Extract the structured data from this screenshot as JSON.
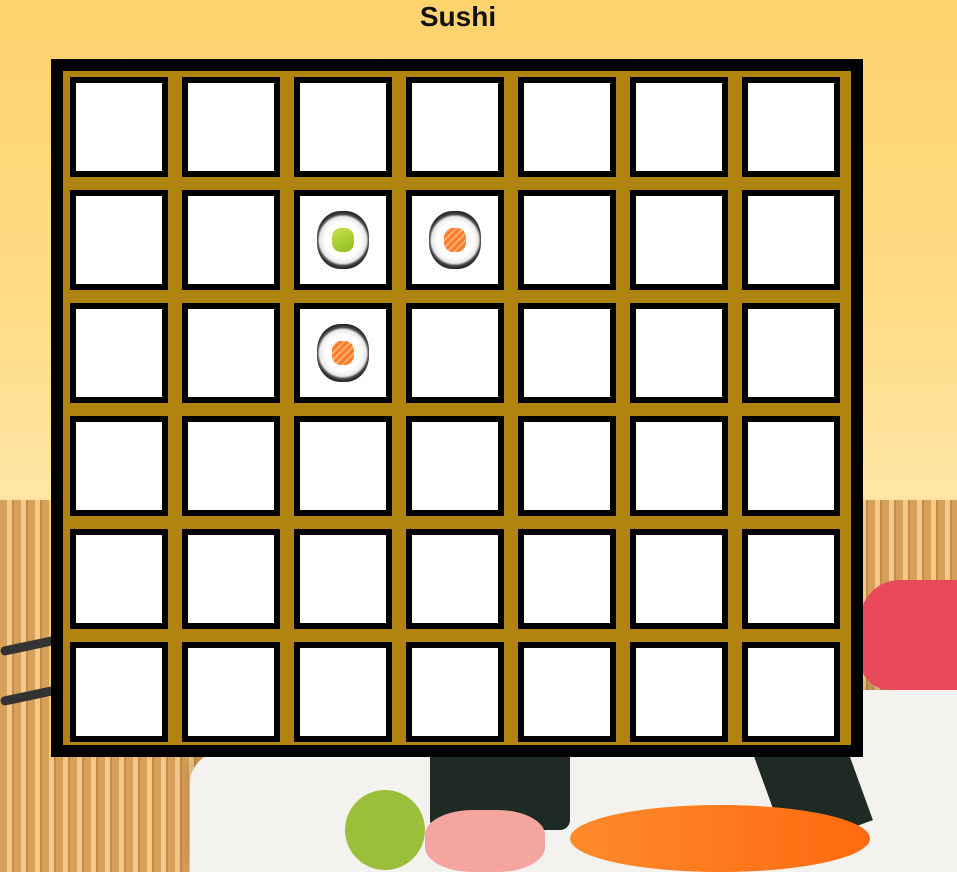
{
  "title": "Sushi",
  "board": {
    "rows": 6,
    "cols": 7,
    "pieces": [
      {
        "row": 1,
        "col": 2,
        "type": "avocado-roll"
      },
      {
        "row": 1,
        "col": 3,
        "type": "salmon-roll"
      },
      {
        "row": 2,
        "col": 2,
        "type": "salmon-roll"
      }
    ]
  },
  "colors": {
    "board_frame": "#000000",
    "board_fill": "#b0850f",
    "cell": "#ffffff"
  }
}
